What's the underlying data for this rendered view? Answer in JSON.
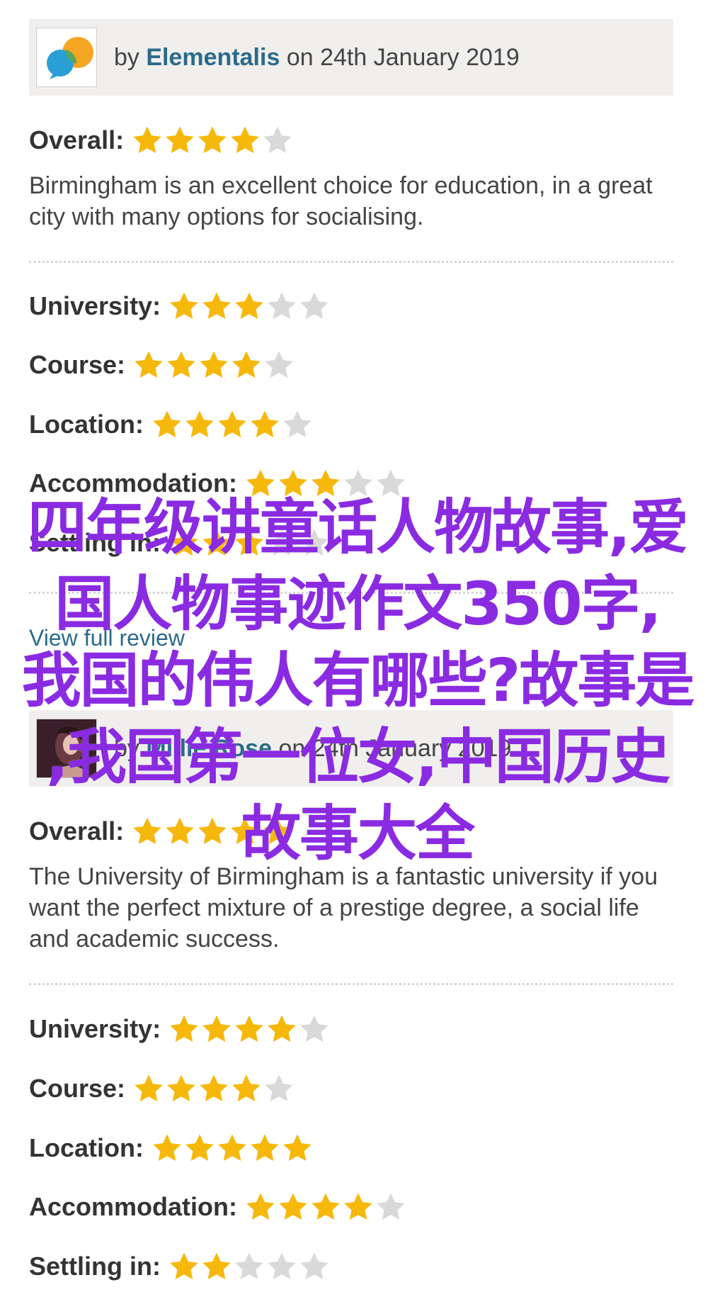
{
  "colors": {
    "star_filled": "#f6b80a",
    "star_empty": "#d9d9d9",
    "author": "#2b6a8a",
    "overlay": "#8a2be2"
  },
  "labels": {
    "overall": "Overall:",
    "university": "University:",
    "course": "Course:",
    "location": "Location:",
    "accommodation": "Accommodation:",
    "settling": "Settling in:"
  },
  "reviews": [
    {
      "by": "by",
      "author": "Elementalis",
      "date": "on 24th January 2019",
      "avatar_icon": "speech-bubbles-logo-icon",
      "overall_stars": 4,
      "text": "Birmingham is an excellent choice for education, in a great city with many options for socialising.",
      "ratings": {
        "university": 3,
        "course": 4,
        "location": 4,
        "accommodation": 3,
        "settling": 3
      },
      "view_full": "View full review"
    },
    {
      "by": "by",
      "author": "Millie Rose",
      "date": "on 24th January 2019",
      "avatar_icon": "user-photo-avatar",
      "overall_stars": 5,
      "text": "The University of Birmingham is a fantastic university if you want the perfect mixture of a prestige degree, a social life and academic success.",
      "ratings": {
        "university": 4,
        "course": 4,
        "location": 5,
        "accommodation": 4,
        "settling": 2
      }
    }
  ],
  "overlay_text": "四年级讲童话人物故事,爱\n国人物事迹作文350字,\n我国的伟人有哪些?故事是\n,我国第一位女,中国历史\n故事大全"
}
